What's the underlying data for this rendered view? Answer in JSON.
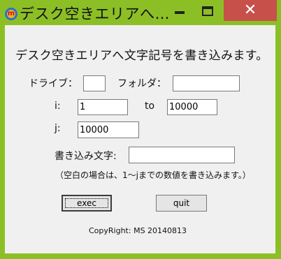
{
  "window": {
    "title": "デスク空きエリアへ…",
    "app_icon_letter": "m",
    "controls": {
      "minimize": "",
      "maximize": "",
      "close": "✕"
    }
  },
  "heading": "デスク空きエリアへ文字記号を書き込みます。",
  "form": {
    "drive_label": "ドライブ：",
    "drive_value": "",
    "folder_label": "フォルダ：",
    "folder_value": "",
    "i_label": "i:",
    "i_value": "1",
    "to_label": "to",
    "to_value": "10000",
    "j_label": "j:",
    "j_value": "10000",
    "text_label": "書き込み文字:",
    "text_value": ""
  },
  "note": "（空白の場合は、1～jまでの数値を書き込みます。）",
  "buttons": {
    "exec": "exec",
    "quit": "quit"
  },
  "copyright": "CopyRight: MS 20140813"
}
